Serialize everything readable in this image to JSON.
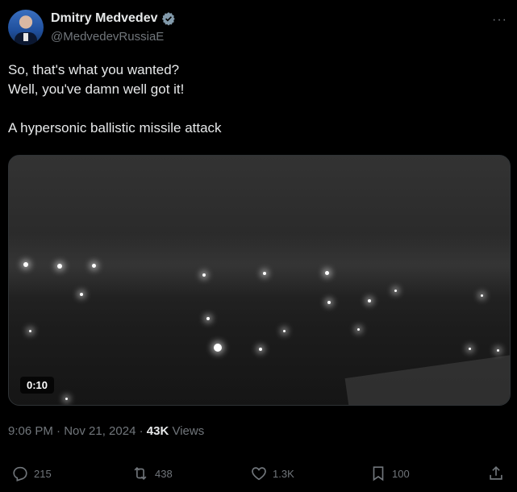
{
  "author": {
    "name": "Dmitry Medvedev",
    "handle": "@MedvedevRussiaE"
  },
  "tweet": {
    "lines": [
      "So, that's what you wanted?",
      "Well, you've damn well got it!",
      "",
      "A hypersonic ballistic missile attack"
    ]
  },
  "video": {
    "duration": "0:10"
  },
  "meta": {
    "time_date": "9:06 PM · Nov 21, 2024 · ",
    "views_count": "43K",
    "views_label": " Views"
  },
  "actions": {
    "replies": "215",
    "reposts": "438",
    "likes": "1.3K",
    "bookmarks": "100"
  },
  "colors": {
    "background": "#000000",
    "text": "#e7e9ea",
    "muted": "#71767b",
    "verified": "#829aab"
  }
}
